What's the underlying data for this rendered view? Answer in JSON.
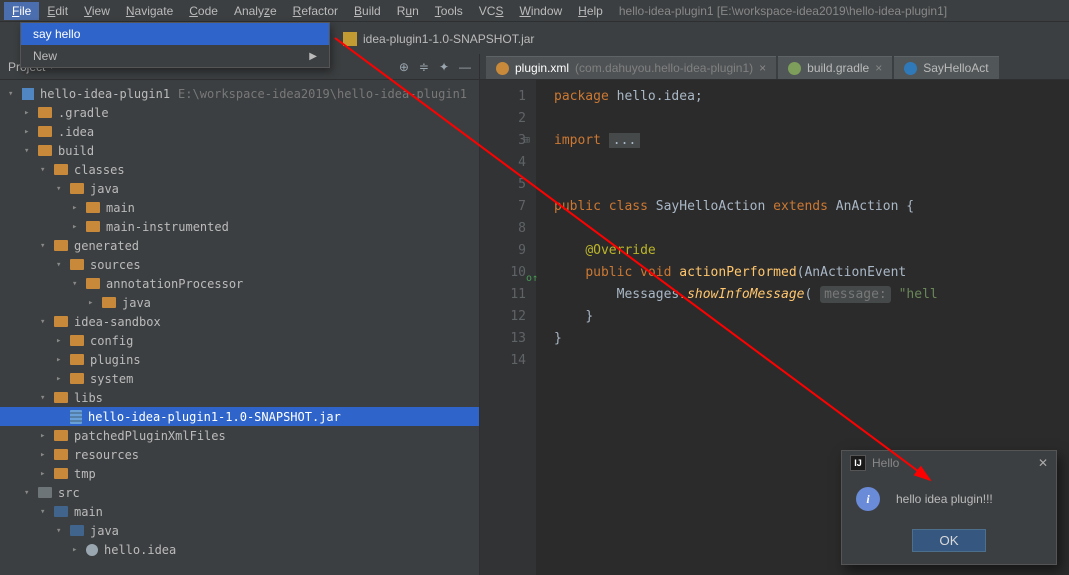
{
  "menubar": {
    "items": [
      "File",
      "Edit",
      "View",
      "Navigate",
      "Code",
      "Analyze",
      "Refactor",
      "Build",
      "Run",
      "Tools",
      "VCS",
      "Window",
      "Help"
    ],
    "active_index": 0,
    "window_title": "hello-idea-plugin1 [E:\\workspace-idea2019\\hello-idea-plugin1]"
  },
  "dropdown": {
    "items": [
      {
        "label": "say hello",
        "selected": true,
        "submenu": false
      },
      {
        "label": "New",
        "selected": false,
        "submenu": true
      }
    ]
  },
  "breadcrumb": {
    "file": "idea-plugin1-1.0-SNAPSHOT.jar"
  },
  "project": {
    "tool_label": "Project",
    "root": {
      "name": "hello-idea-plugin1",
      "path": "E:\\workspace-idea2019\\hello-idea-plugin1"
    },
    "tree": [
      {
        "d": 0,
        "name": "hello-idea-plugin1",
        "type": "module",
        "arrow": "▾",
        "hint": "E:\\workspace-idea2019\\hello-idea-plugin1"
      },
      {
        "d": 1,
        "name": ".gradle",
        "type": "folder",
        "arrow": "▸"
      },
      {
        "d": 1,
        "name": ".idea",
        "type": "folder",
        "arrow": "▸"
      },
      {
        "d": 1,
        "name": "build",
        "type": "folder",
        "arrow": "▾"
      },
      {
        "d": 2,
        "name": "classes",
        "type": "folder",
        "arrow": "▾"
      },
      {
        "d": 3,
        "name": "java",
        "type": "folder",
        "arrow": "▾"
      },
      {
        "d": 4,
        "name": "main",
        "type": "folder",
        "arrow": "▸"
      },
      {
        "d": 4,
        "name": "main-instrumented",
        "type": "folder",
        "arrow": "▸"
      },
      {
        "d": 2,
        "name": "generated",
        "type": "folder",
        "arrow": "▾"
      },
      {
        "d": 3,
        "name": "sources",
        "type": "folder",
        "arrow": "▾"
      },
      {
        "d": 4,
        "name": "annotationProcessor",
        "type": "folder",
        "arrow": "▾"
      },
      {
        "d": 5,
        "name": "java",
        "type": "folder",
        "arrow": "▸"
      },
      {
        "d": 2,
        "name": "idea-sandbox",
        "type": "folder",
        "arrow": "▾"
      },
      {
        "d": 3,
        "name": "config",
        "type": "folder",
        "arrow": "▸"
      },
      {
        "d": 3,
        "name": "plugins",
        "type": "folder",
        "arrow": "▸"
      },
      {
        "d": 3,
        "name": "system",
        "type": "folder",
        "arrow": "▸"
      },
      {
        "d": 2,
        "name": "libs",
        "type": "folder",
        "arrow": "▾"
      },
      {
        "d": 3,
        "name": "hello-idea-plugin1-1.0-SNAPSHOT.jar",
        "type": "jar",
        "arrow": "",
        "selected": true
      },
      {
        "d": 2,
        "name": "patchedPluginXmlFiles",
        "type": "folder",
        "arrow": "▸"
      },
      {
        "d": 2,
        "name": "resources",
        "type": "folder",
        "arrow": "▸"
      },
      {
        "d": 2,
        "name": "tmp",
        "type": "folder",
        "arrow": "▸"
      },
      {
        "d": 1,
        "name": "src",
        "type": "folder-gray",
        "arrow": "▾"
      },
      {
        "d": 2,
        "name": "main",
        "type": "folder-blue",
        "arrow": "▾"
      },
      {
        "d": 3,
        "name": "java",
        "type": "folder-blue",
        "arrow": "▾"
      },
      {
        "d": 4,
        "name": "hello.idea",
        "type": "pkg",
        "arrow": "▸"
      }
    ]
  },
  "editor": {
    "tabs": [
      {
        "label": "plugin.xml",
        "context": "(com.dahuyou.hello-idea-plugin1)",
        "active": true,
        "icon_color": "#c88a3a"
      },
      {
        "label": "build.gradle",
        "context": "",
        "active": false,
        "icon_color": "#7e9e5b"
      },
      {
        "label": "SayHelloAct",
        "context": "",
        "active": false,
        "icon_color": "#2f79b9"
      }
    ],
    "lines": [
      1,
      2,
      3,
      4,
      5,
      7,
      8,
      9,
      10,
      11,
      12,
      13,
      14
    ],
    "code": {
      "pkg_kw": "package",
      "pkg_name": "hello.idea;",
      "import_kw": "import",
      "import_dots": "...",
      "public": "public",
      "class": "class",
      "cls_name": "SayHelloAction",
      "ext": "extends",
      "super": "AnAction",
      "brace_open": "{",
      "override": "@Override",
      "void": "void",
      "method": "actionPerformed",
      "param": "(AnActionEvent ",
      "msgs": "Messages",
      "show": ".showInfoMessage",
      "open": "(",
      "hint": "message:",
      "strlit": "\"hell",
      "brace_close": "}",
      "outer_close": "}"
    }
  },
  "dialog": {
    "title": "Hello",
    "info_char": "i",
    "message": "hello idea plugin!!!",
    "ok": "OK"
  }
}
